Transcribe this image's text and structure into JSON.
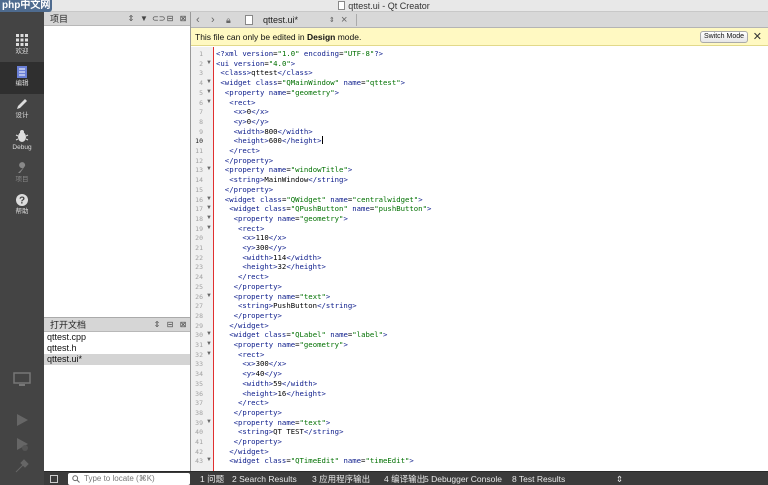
{
  "window": {
    "title": "qttest.ui - Qt Creator",
    "logo": "php中文网"
  },
  "modes": [
    {
      "label": "欢迎",
      "icon": "grid-icon"
    },
    {
      "label": "编辑",
      "icon": "edit-doc-icon",
      "active": true
    },
    {
      "label": "设计",
      "icon": "pencil-icon"
    },
    {
      "label": "Debug",
      "icon": "bug-icon"
    },
    {
      "label": "项目",
      "icon": "wrench-icon",
      "disabled": true
    },
    {
      "label": "帮助",
      "icon": "help-icon"
    }
  ],
  "project_panel": {
    "title": "项目"
  },
  "open_documents": {
    "title": "打开文档",
    "items": [
      "qttest.cpp",
      "qttest.h",
      "qttest.ui*"
    ],
    "selected_index": 2
  },
  "editor": {
    "file_name": "qttest.ui*",
    "info_message_prefix": "This file can only be edited in ",
    "info_message_bold": "Design",
    "info_message_suffix": " mode.",
    "switch_mode_label": "Switch Mode",
    "current_line": 10,
    "lines": [
      "<?xml version=\"1.0\" encoding=\"UTF-8\"?>",
      "<ui version=\"4.0\">",
      " <class>qttest</class>",
      " <widget class=\"QMainWindow\" name=\"qttest\">",
      "  <property name=\"geometry\">",
      "   <rect>",
      "    <x>0</x>",
      "    <y>0</y>",
      "    <width>800</width>",
      "    <height>600</height>",
      "   </rect>",
      "  </property>",
      "  <property name=\"windowTitle\">",
      "   <string>MainWindow</string>",
      "  </property>",
      "  <widget class=\"QWidget\" name=\"centralwidget\">",
      "   <widget class=\"QPushButton\" name=\"pushButton\">",
      "    <property name=\"geometry\">",
      "     <rect>",
      "      <x>110</x>",
      "      <y>300</y>",
      "      <width>114</width>",
      "      <height>32</height>",
      "     </rect>",
      "    </property>",
      "    <property name=\"text\">",
      "     <string>PushButton</string>",
      "    </property>",
      "   </widget>",
      "   <widget class=\"QLabel\" name=\"label\">",
      "    <property name=\"geometry\">",
      "     <rect>",
      "      <x>300</x>",
      "      <y>40</y>",
      "      <width>59</width>",
      "      <height>16</height>",
      "     </rect>",
      "    </property>",
      "    <property name=\"text\">",
      "     <string>QT TEST</string>",
      "    </property>",
      "   </widget>",
      "   <widget class=\"QTimeEdit\" name=\"timeEdit\">"
    ],
    "fold_lines": [
      2,
      4,
      5,
      6,
      13,
      16,
      17,
      18,
      19,
      26,
      30,
      31,
      32,
      39,
      43
    ]
  },
  "bottom_bar": {
    "locator_placeholder": "Type to locate (⌘K)",
    "tabs": [
      {
        "num": "1",
        "label": "问题"
      },
      {
        "num": "2",
        "label": "Search Results"
      },
      {
        "num": "3",
        "label": "应用程序输出"
      },
      {
        "num": "4",
        "label": "编译输出"
      },
      {
        "num": "5",
        "label": "Debugger Console"
      },
      {
        "num": "8",
        "label": "Test Results"
      }
    ]
  }
}
